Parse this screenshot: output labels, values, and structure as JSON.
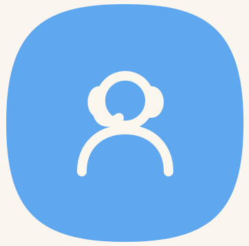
{
  "app_icon": {
    "icon": "customer-support-headset-icon",
    "background_color": "#5fa8ef",
    "glyph_color": "#fbf7ef",
    "page_background": "#faf6ef"
  }
}
